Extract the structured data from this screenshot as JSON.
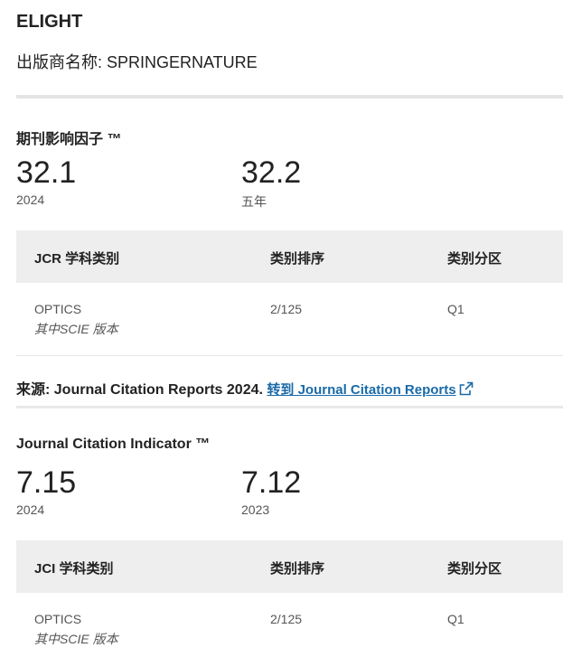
{
  "journal": {
    "title": "ELIGHT",
    "publisher": "出版商名称: SPRINGERNATURE"
  },
  "jif": {
    "section_title": "期刊影响因子 ™",
    "metrics": [
      {
        "value": "32.1",
        "caption": "2024"
      },
      {
        "value": "32.2",
        "caption": "五年"
      }
    ],
    "table": {
      "headers": [
        "JCR 学科类别",
        "类别排序",
        "类别分区"
      ],
      "rows": [
        {
          "category": "OPTICS",
          "edition": "其中SCIE 版本",
          "rank": "2/125",
          "quartile": "Q1"
        }
      ]
    }
  },
  "source": {
    "label": "来源: Journal Citation Reports  2024.",
    "link_text": "转到 Journal Citation Reports",
    "icon": "external-link-icon",
    "link_color": "#1a6aa8"
  },
  "jci": {
    "section_title": "Journal Citation Indicator ™",
    "metrics": [
      {
        "value": "7.15",
        "caption": "2024"
      },
      {
        "value": "7.12",
        "caption": "2023"
      }
    ],
    "table": {
      "headers": [
        "JCI 学科类别",
        "类别排序",
        "类别分区"
      ],
      "rows": [
        {
          "category": "OPTICS",
          "edition": "其中SCIE 版本",
          "rank": "2/125",
          "quartile": "Q1"
        }
      ]
    }
  }
}
